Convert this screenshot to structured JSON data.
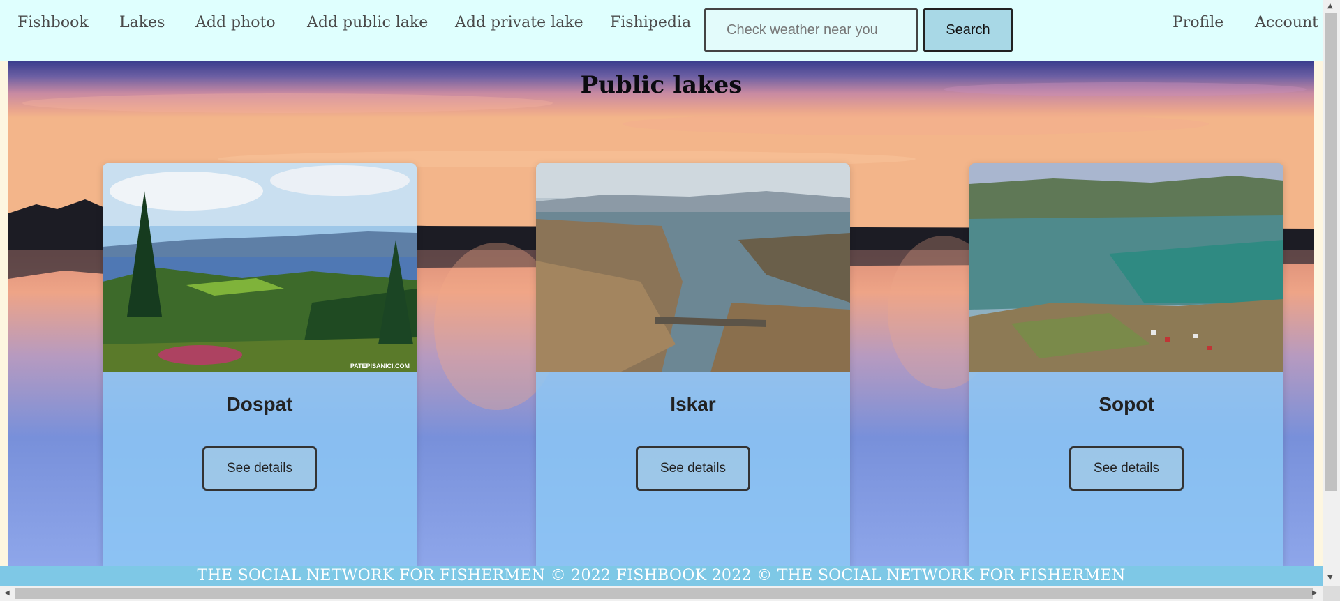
{
  "nav": {
    "items": [
      "Fishbook",
      "Lakes",
      "Add photo",
      "Add public lake",
      "Add private lake",
      "Fishipedia"
    ],
    "right_items": [
      "Profile",
      "Account"
    ],
    "search_placeholder": "Check weather near you",
    "search_button": "Search"
  },
  "main": {
    "title": "Public lakes",
    "cards": [
      {
        "name": "Dospat",
        "button": "See details",
        "watermark": "PATEPISANICI.COM"
      },
      {
        "name": "Iskar",
        "button": "See details"
      },
      {
        "name": "Sopot",
        "button": "See details"
      }
    ]
  },
  "footer": {
    "text": "THE SOCIAL NETWORK FOR FISHERMEN © 2022 FISHBOOK 2022 © THE SOCIAL NETWORK FOR FISHERMEN"
  },
  "colors": {
    "navbar_bg": "#dffffe",
    "footer_bg": "#7ec8e6",
    "card_bg": "#8cc8f5",
    "search_button_bg": "#a8d8e6"
  },
  "icons": [
    "scroll-up-arrow-icon",
    "scroll-down-arrow-icon",
    "scroll-left-arrow-icon",
    "scroll-right-arrow-icon"
  ]
}
